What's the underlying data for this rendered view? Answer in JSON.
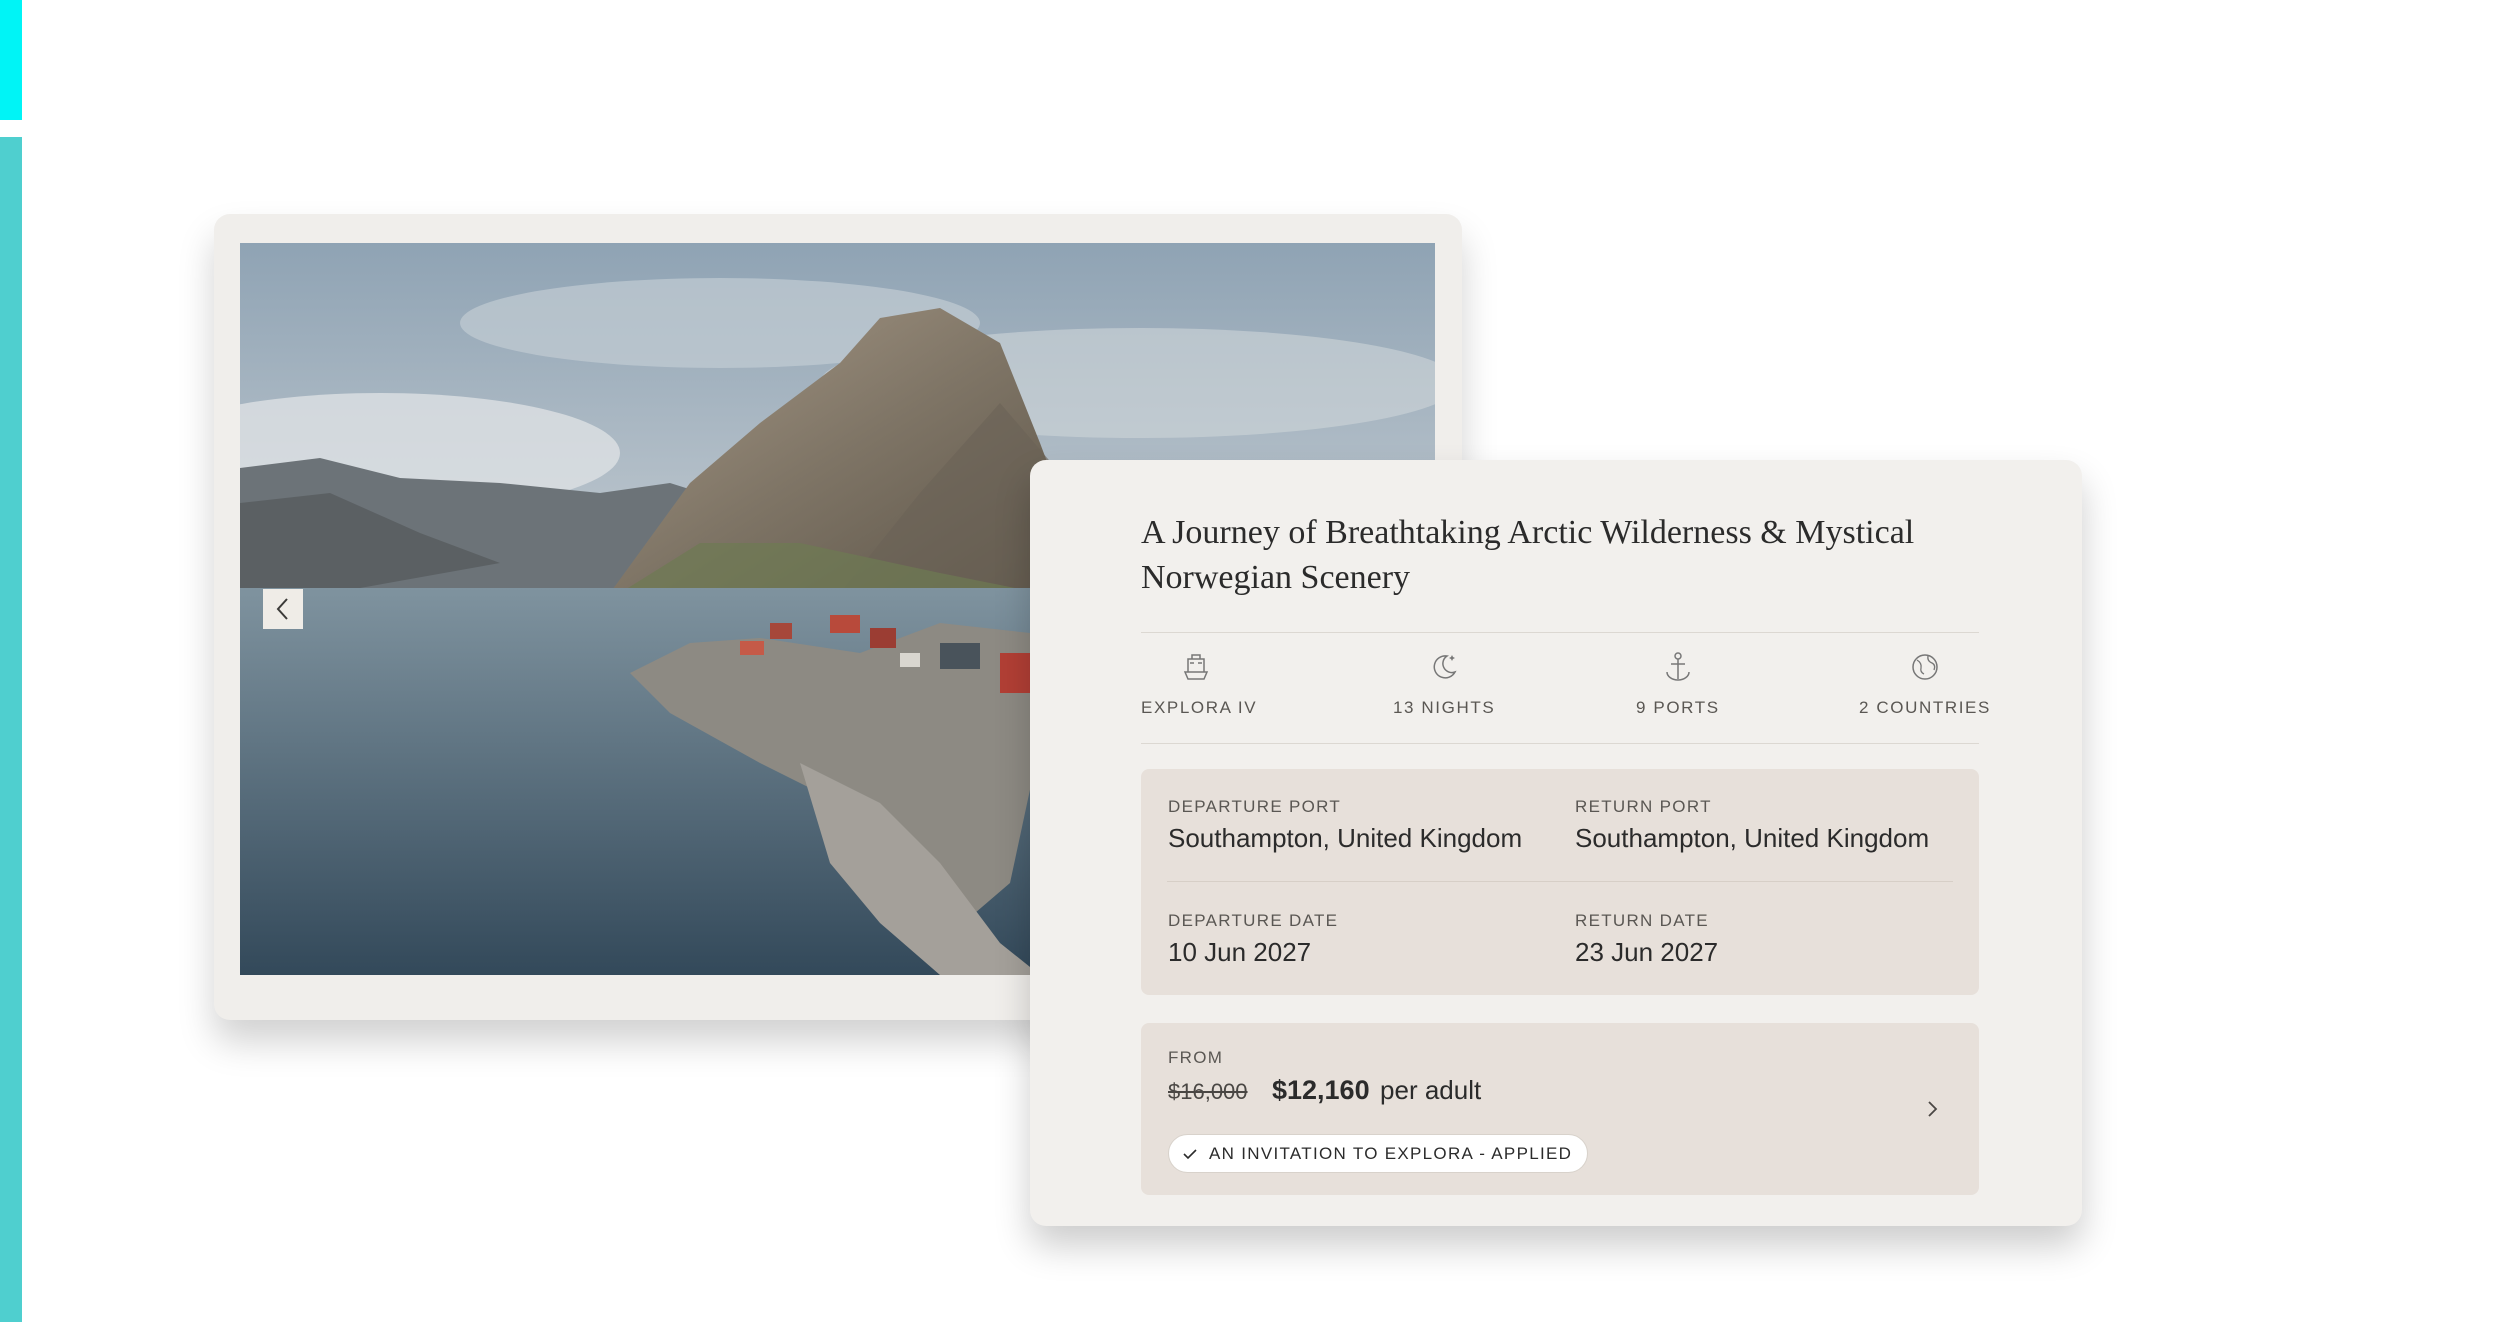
{
  "carousel": {
    "prev_icon": "chevron-left-icon"
  },
  "cruise": {
    "title": "A Journey of Breathtaking Arctic Wilderness & Mystical Norwegian Scenery",
    "facts": [
      {
        "icon": "ship-icon",
        "label": "EXPLORA IV"
      },
      {
        "icon": "moon-star-icon",
        "label": "13 NIGHTS"
      },
      {
        "icon": "anchor-icon",
        "label": "9 PORTS"
      },
      {
        "icon": "globe-icon",
        "label": "2 COUNTRIES"
      }
    ],
    "ports": {
      "departure_port_label": "DEPARTURE PORT",
      "departure_port": "Southampton, United Kingdom",
      "return_port_label": "RETURN PORT",
      "return_port": "Southampton, United Kingdom",
      "departure_date_label": "DEPARTURE DATE",
      "departure_date": "10 Jun 2027",
      "return_date_label": "RETURN DATE",
      "return_date": "23 Jun 2027"
    },
    "pricing": {
      "from_label": "FROM",
      "old_price": "$16,000",
      "new_price": "$12,160",
      "per_unit": "per adult",
      "offer_badge": "AN INVITATION TO EXPLORA - APPLIED"
    }
  },
  "colors": {
    "accent_bar": "#4fcfcf",
    "accent_bar_top": "#00f4f6",
    "card_background": "#f2f0ed",
    "info_box_background": "#e7e0da"
  }
}
